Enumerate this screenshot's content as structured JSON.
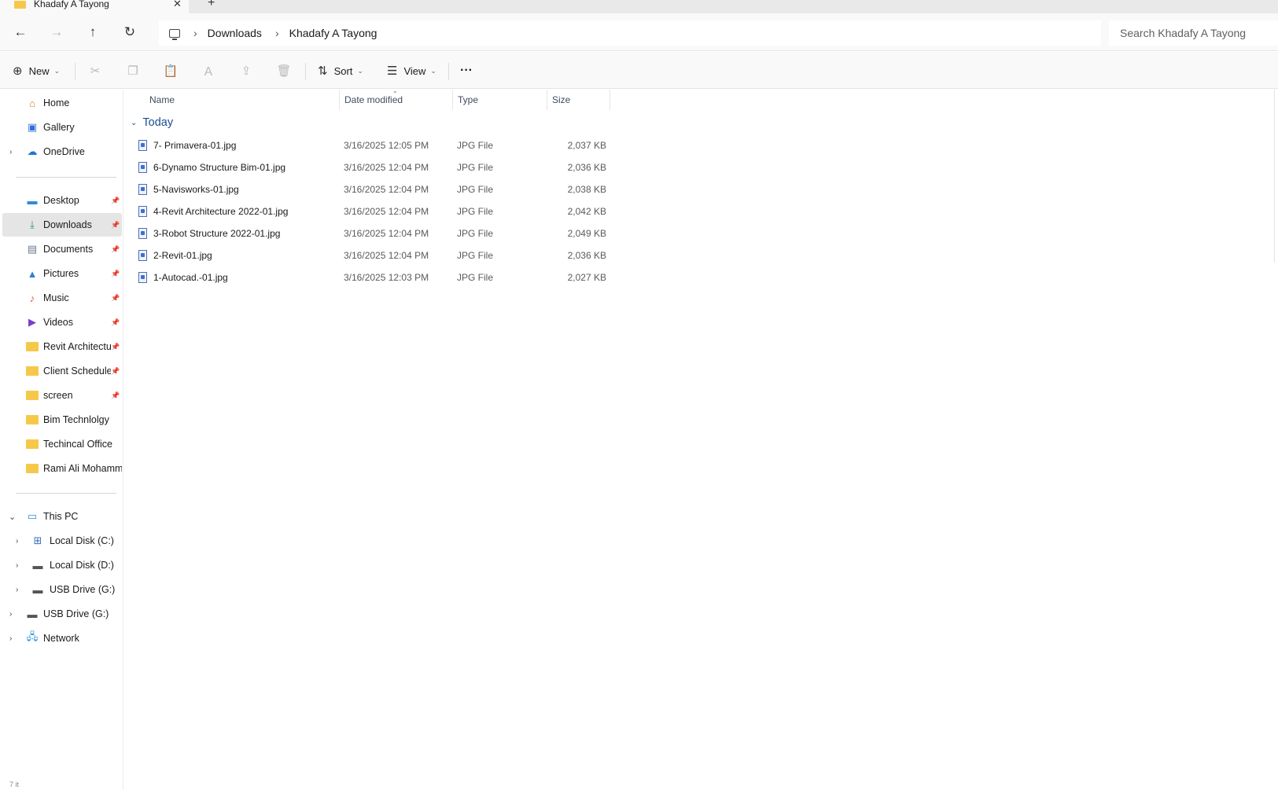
{
  "window": {
    "tab_title": "Khadafy A Tayong",
    "tab_close": "✕",
    "tab_new": "+"
  },
  "addressbar": {
    "back": "←",
    "forward": "→",
    "up": "↑",
    "refresh": "↻",
    "crumbs": [
      "Downloads",
      "Khadafy A Tayong"
    ],
    "separator": "›",
    "search_placeholder": "Search Khadafy A Tayong"
  },
  "commandbar": {
    "new_label": "New",
    "sort_label": "Sort",
    "view_label": "View",
    "more_label": "···",
    "icons": [
      "cut-icon",
      "copy-icon",
      "paste-icon",
      "rename-icon",
      "share-icon",
      "delete-icon"
    ]
  },
  "sidebar": {
    "quick": [
      {
        "label": "Home",
        "icon": "home-icon"
      },
      {
        "label": "Gallery",
        "icon": "gallery-icon"
      },
      {
        "label": "OneDrive",
        "icon": "onedrive-icon"
      }
    ],
    "pinned": [
      {
        "label": "Desktop",
        "icon": "desktop-icon",
        "pinned": true
      },
      {
        "label": "Downloads",
        "icon": "downloads-icon",
        "pinned": true,
        "selected": true
      },
      {
        "label": "Documents",
        "icon": "documents-icon",
        "pinned": true
      },
      {
        "label": "Pictures",
        "icon": "pictures-icon",
        "pinned": true
      },
      {
        "label": "Music",
        "icon": "music-icon",
        "pinned": true
      },
      {
        "label": "Videos",
        "icon": "videos-icon",
        "pinned": true
      },
      {
        "label": "Revit Architectu",
        "icon": "folder-icon",
        "pinned": true
      },
      {
        "label": "Client Schedules",
        "icon": "folder-icon",
        "pinned": true
      },
      {
        "label": "screen",
        "icon": "folder-icon",
        "pinned": true
      },
      {
        "label": "Bim Technlolgy",
        "icon": "folder-icon",
        "pinned": false
      },
      {
        "label": "Techincal Office",
        "icon": "folder-icon",
        "pinned": false
      },
      {
        "label": "Rami Ali Mohamm",
        "icon": "folder-icon",
        "pinned": false
      }
    ],
    "thispc": {
      "label": "This PC"
    },
    "drives": [
      {
        "label": "Local Disk (C:)"
      },
      {
        "label": "Local Disk (D:)"
      },
      {
        "label": "USB Drive (G:)"
      }
    ],
    "root_items": [
      {
        "label": "USB Drive (G:)"
      },
      {
        "label": "Network"
      }
    ]
  },
  "content": {
    "columns": {
      "name": "Name",
      "date": "Date modified",
      "type": "Type",
      "size": "Size"
    },
    "group_label": "Today",
    "files": [
      {
        "name": "7- Primavera-01.jpg",
        "date": "3/16/2025 12:05 PM",
        "type": "JPG File",
        "size": "2,037 KB"
      },
      {
        "name": "6-Dynamo Structure Bim-01.jpg",
        "date": "3/16/2025 12:04 PM",
        "type": "JPG File",
        "size": "2,036 KB"
      },
      {
        "name": "5-Navisworks-01.jpg",
        "date": "3/16/2025 12:04 PM",
        "type": "JPG File",
        "size": "2,038 KB"
      },
      {
        "name": "4-Revit  Architecture 2022-01.jpg",
        "date": "3/16/2025 12:04 PM",
        "type": "JPG File",
        "size": "2,042 KB"
      },
      {
        "name": "3-Robot Structure 2022-01.jpg",
        "date": "3/16/2025 12:04 PM",
        "type": "JPG File",
        "size": "2,049 KB"
      },
      {
        "name": "2-Revit-01.jpg",
        "date": "3/16/2025 12:04 PM",
        "type": "JPG File",
        "size": "2,036 KB"
      },
      {
        "name": "1-Autocad.-01.jpg",
        "date": "3/16/2025 12:03 PM",
        "type": "JPG File",
        "size": "2,027 KB"
      }
    ]
  },
  "status": {
    "text": "7 it"
  },
  "colors": {
    "accent": "#1a4d8f",
    "selected_bg": "#e5e5e5",
    "folder": "#f6c84a"
  }
}
